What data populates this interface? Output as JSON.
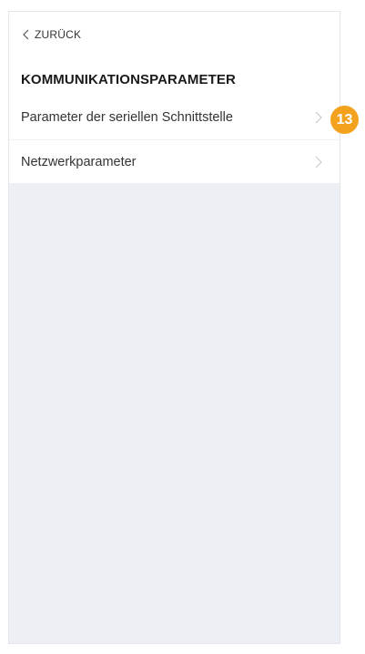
{
  "header": {
    "back_label": "ZURÜCK",
    "title": "KOMMUNIKATIONSPARAMETER"
  },
  "list": {
    "items": [
      {
        "label": "Parameter der seriellen Schnittstelle",
        "icon": "chevron-right-icon"
      },
      {
        "label": "Netzwerkparameter",
        "icon": "chevron-right-icon"
      }
    ]
  },
  "annotation": {
    "badge_number": "13",
    "badge_color": "#f3a21d"
  },
  "colors": {
    "background": "#ecf0f5",
    "surface": "#ffffff",
    "text": "#333333",
    "chevron": "#c8ccd1"
  }
}
